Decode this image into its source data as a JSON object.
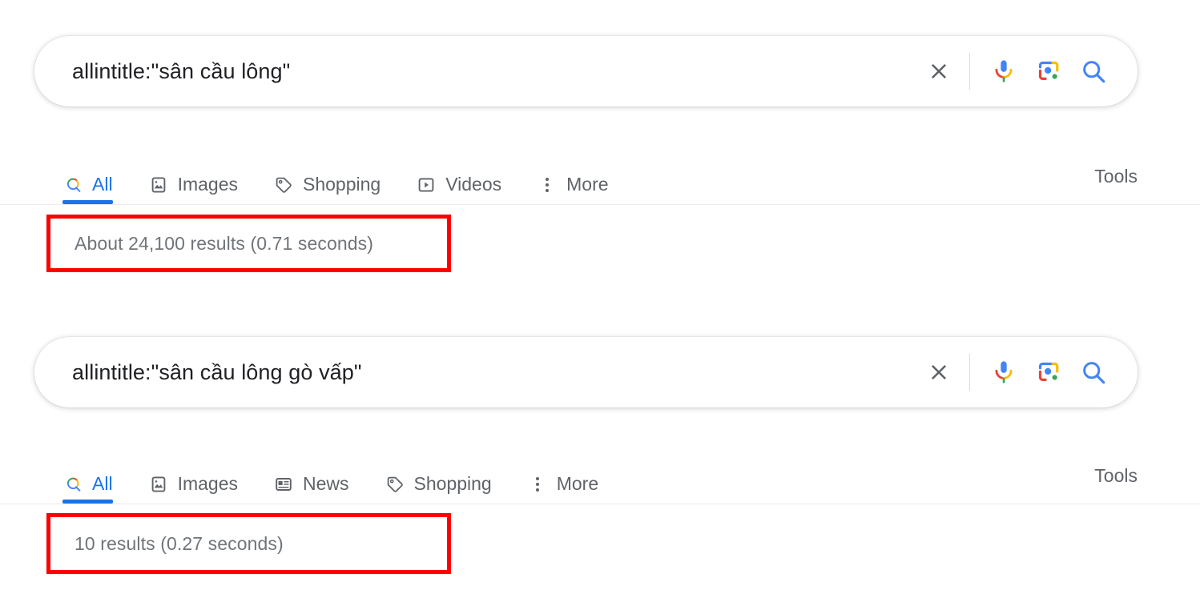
{
  "colors": {
    "google_blue": "#1a73e8",
    "google_red": "#ea4335",
    "google_yellow": "#fbbc05",
    "google_green": "#34a853",
    "callout_red": "#fe0000",
    "text_gray": "#5f6368",
    "stats_gray": "#70757a"
  },
  "searches": [
    {
      "id": "search-1",
      "query": "allintitle:\"sân cầu lông\"",
      "placeholder": "Search",
      "actions": [
        {
          "name": "clear-icon",
          "label": "Clear"
        },
        {
          "name": "microphone-icon",
          "label": "Search by voice"
        },
        {
          "name": "google-lens-icon",
          "label": "Search by image"
        },
        {
          "name": "search-icon",
          "label": "Google Search"
        }
      ],
      "tabs": [
        {
          "label": "All",
          "icon": "google-search-icon",
          "active": true
        },
        {
          "label": "Images",
          "icon": "image-icon",
          "active": false
        },
        {
          "label": "Shopping",
          "icon": "tag-icon",
          "active": false
        },
        {
          "label": "Videos",
          "icon": "video-icon",
          "active": false
        },
        {
          "label": "More",
          "icon": "more-dots-icon",
          "active": false
        }
      ],
      "tools_label": "Tools",
      "result_stats": "About 24,100 results (0.71 seconds)"
    },
    {
      "id": "search-2",
      "query": "allintitle:\"sân cầu lông gò vấp\"",
      "placeholder": "Search",
      "actions": [
        {
          "name": "clear-icon",
          "label": "Clear"
        },
        {
          "name": "microphone-icon",
          "label": "Search by voice"
        },
        {
          "name": "google-lens-icon",
          "label": "Search by image"
        },
        {
          "name": "search-icon",
          "label": "Google Search"
        }
      ],
      "tabs": [
        {
          "label": "All",
          "icon": "google-search-icon",
          "active": true
        },
        {
          "label": "Images",
          "icon": "image-icon",
          "active": false
        },
        {
          "label": "News",
          "icon": "news-icon",
          "active": false
        },
        {
          "label": "Shopping",
          "icon": "tag-icon",
          "active": false
        },
        {
          "label": "More",
          "icon": "more-dots-icon",
          "active": false
        }
      ],
      "tools_label": "Tools",
      "result_stats": "10 results (0.27 seconds)"
    }
  ]
}
